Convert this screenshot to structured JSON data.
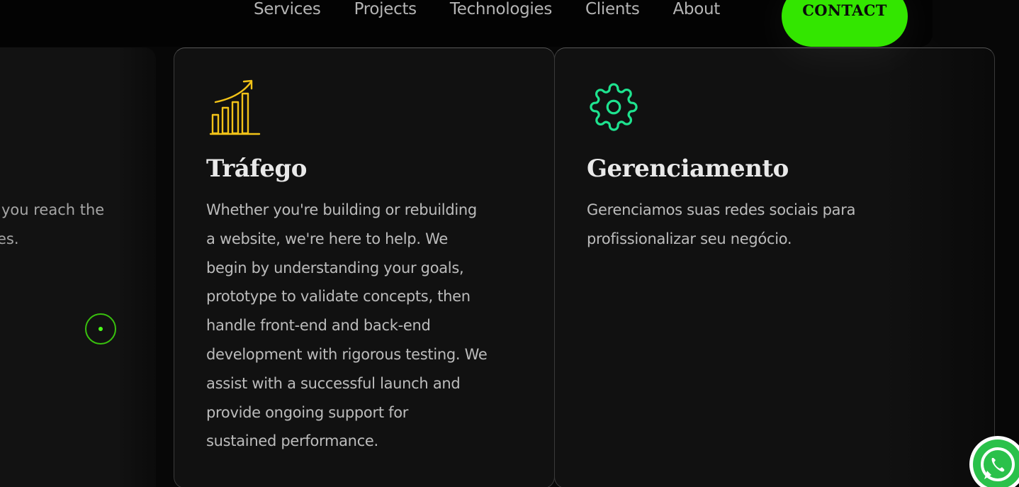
{
  "nav": {
    "items": [
      {
        "label": "Services"
      },
      {
        "label": "Projects"
      },
      {
        "label": "Technologies"
      },
      {
        "label": "Clients"
      },
      {
        "label": "About"
      }
    ],
    "contact_label": "CONTACT"
  },
  "cards": {
    "left": {
      "text_line1": "you reach the",
      "text_line2": "es."
    },
    "middle": {
      "icon": "growth-chart-icon",
      "title": "Tráfego",
      "lines": [
        "Whether you're building or rebuilding",
        "a website, we're here to help. We",
        "begin by understanding your goals,",
        "prototype to validate concepts, then",
        "handle front-end and back-end",
        "development with rigorous testing. We",
        "assist with a successful launch and",
        "provide ongoing support for",
        "sustained performance."
      ]
    },
    "right": {
      "icon": "gear-icon",
      "title": "Gerenciamento",
      "lines": [
        "Gerenciamos suas redes sociais para",
        "profissionalizar seu negócio."
      ]
    }
  },
  "colors": {
    "accent": "#33e600",
    "chart_icon": "#f2c318",
    "gear_icon": "#1ee38f",
    "whatsapp": "#2ac14a"
  },
  "floating": {
    "whatsapp_icon": "whatsapp-icon"
  }
}
